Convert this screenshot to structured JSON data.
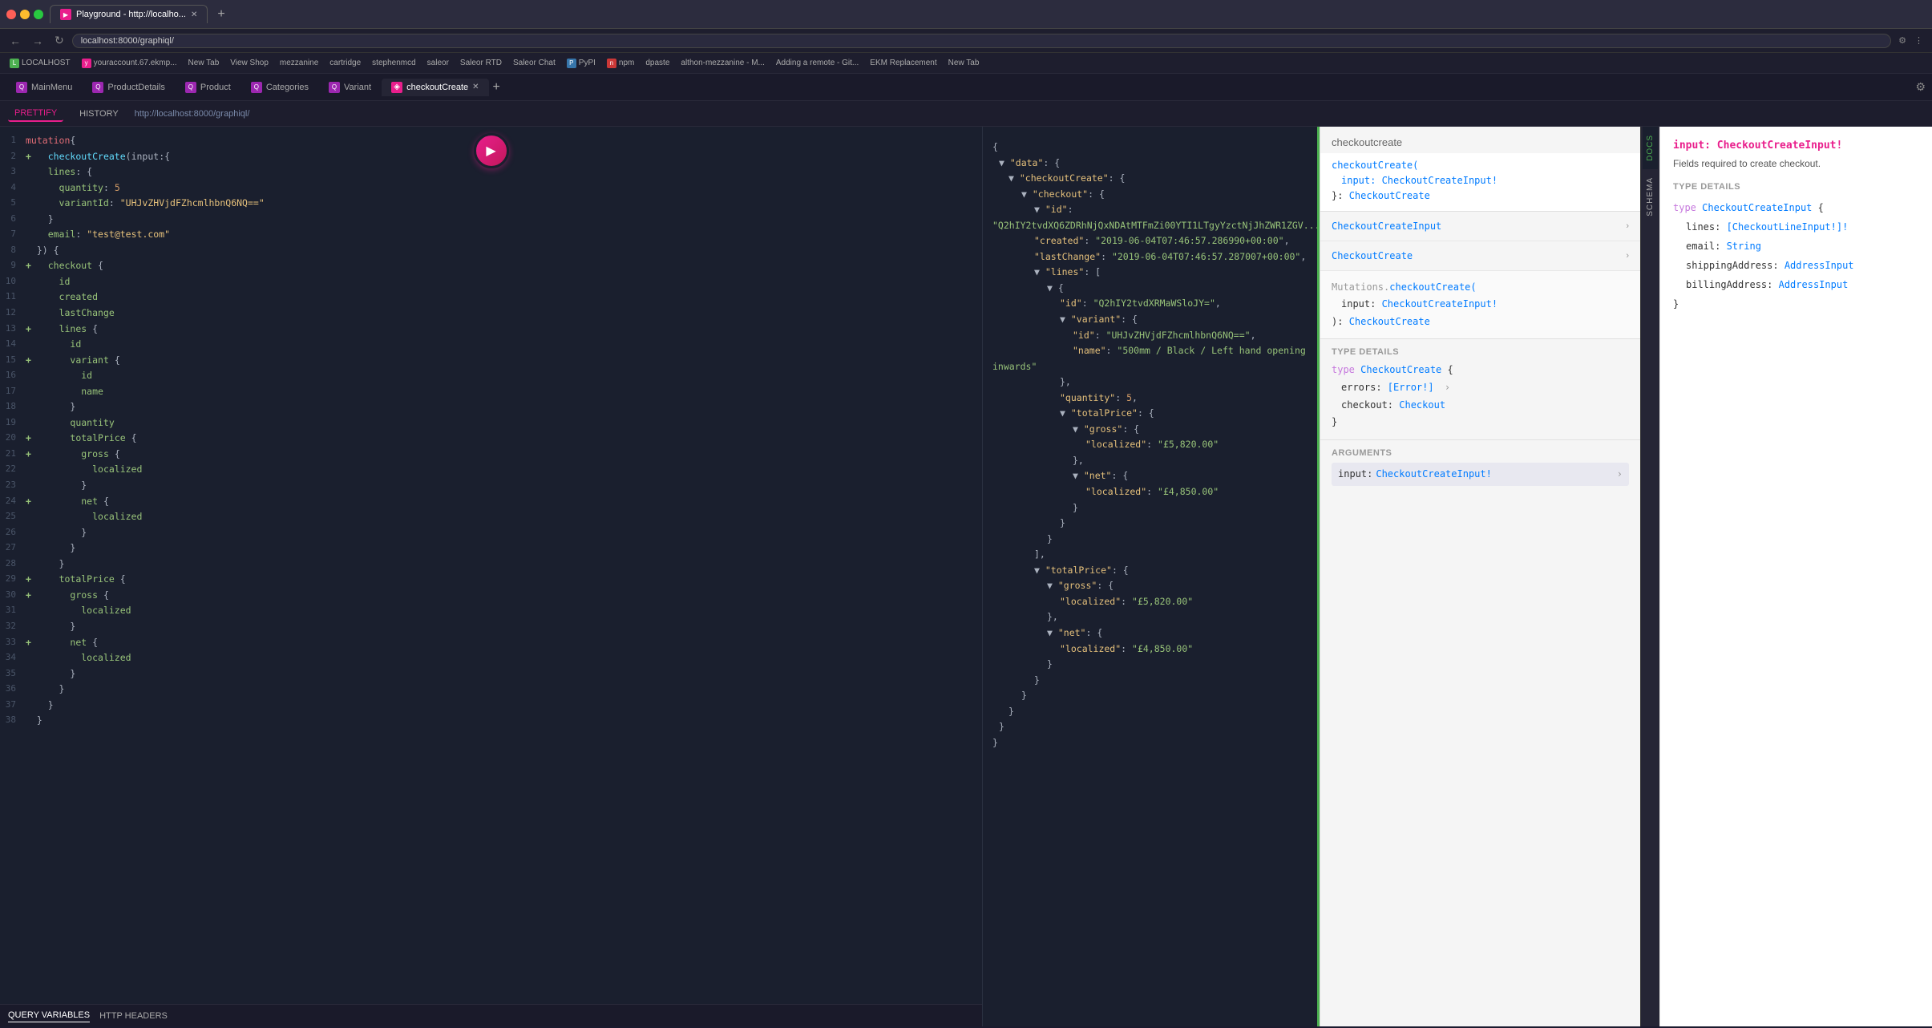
{
  "browser": {
    "tab_label": "Playground - http://localho...",
    "favicon": "▶",
    "url": "localhost:8000/graphiql/",
    "new_tab": "+"
  },
  "bookmarks": [
    {
      "label": "LOCALHOST",
      "color": "#4CAF50"
    },
    {
      "label": "youraccount.67.ekmp...",
      "color": "#e91e8c"
    },
    {
      "label": "New Tab"
    },
    {
      "label": "View Shop"
    },
    {
      "label": "mezzanine"
    },
    {
      "label": "cartridge"
    },
    {
      "label": "stephenmcd"
    },
    {
      "label": "saleor"
    },
    {
      "label": "Saleor RTD"
    },
    {
      "label": "Saleor Chat"
    },
    {
      "label": "PyPI"
    },
    {
      "label": "npm"
    },
    {
      "label": "dpaste"
    },
    {
      "label": "althon-mezzanine - M..."
    },
    {
      "label": "Adding a remote - Git..."
    },
    {
      "label": "EKM Replacement"
    },
    {
      "label": "New Tab"
    }
  ],
  "app_tabs": [
    {
      "label": "MainMenu",
      "icon": "Q",
      "icon_color": "#9c27b0",
      "active": false
    },
    {
      "label": "ProductDetails",
      "icon": "Q",
      "icon_color": "#9c27b0",
      "active": false
    },
    {
      "label": "Product",
      "icon": "Q",
      "icon_color": "#9c27b0",
      "active": false
    },
    {
      "label": "Categories",
      "icon": "Q",
      "icon_color": "#9c27b0",
      "active": false
    },
    {
      "label": "Variant",
      "icon": "Q",
      "icon_color": "#9c27b0",
      "active": false
    },
    {
      "label": "checkoutCreate",
      "icon": "◈",
      "icon_color": "#e91e8c",
      "active": true,
      "closeable": true
    }
  ],
  "toolbar": {
    "prettify": "PRETTIFY",
    "history": "HISTORY",
    "url": "http://localhost:8000/graphiql/"
  },
  "editor": {
    "lines": [
      {
        "num": "1",
        "content": "mutation{",
        "tokens": [
          {
            "t": "kw",
            "v": "mutation"
          },
          {
            "t": "punc",
            "v": "{"
          }
        ]
      },
      {
        "num": "2",
        "content": "  checkoutCreate(input:{",
        "tokens": [
          {
            "t": "plus",
            "v": "+"
          },
          {
            "t": "fn",
            "v": "  checkoutCreate"
          },
          {
            "t": "punc",
            "v": "(input:{"
          },
          {
            "t": "punc",
            "v": ""
          }
        ]
      },
      {
        "num": "3",
        "content": "    lines: {"
      },
      {
        "num": "4",
        "content": "      quantity: 5"
      },
      {
        "num": "5",
        "content": "      variantId: \"UHJvZHVjdFZhcmlhbnQ6NQ==\""
      },
      {
        "num": "6",
        "content": "    }"
      },
      {
        "num": "7",
        "content": "    email: \"test@test.com\""
      },
      {
        "num": "8",
        "content": "  }) {"
      },
      {
        "num": "9",
        "content": "    checkout {"
      },
      {
        "num": "10",
        "content": "      id"
      },
      {
        "num": "11",
        "content": "      created"
      },
      {
        "num": "12",
        "content": "      lastChange"
      },
      {
        "num": "13",
        "content": "      lines {"
      },
      {
        "num": "14",
        "content": "        id"
      },
      {
        "num": "15",
        "content": "        variant {"
      },
      {
        "num": "16",
        "content": "          id"
      },
      {
        "num": "17",
        "content": "          name"
      },
      {
        "num": "18",
        "content": "        }"
      },
      {
        "num": "19",
        "content": "        quantity"
      },
      {
        "num": "20",
        "content": "        totalPrice {"
      },
      {
        "num": "21",
        "content": "          gross {"
      },
      {
        "num": "22",
        "content": "            localized"
      },
      {
        "num": "23",
        "content": "          }"
      },
      {
        "num": "24",
        "content": "          net {"
      },
      {
        "num": "25",
        "content": "            localized"
      },
      {
        "num": "26",
        "content": "          }"
      },
      {
        "num": "27",
        "content": "        }"
      },
      {
        "num": "28",
        "content": "      }"
      },
      {
        "num": "29",
        "content": "      totalPrice {"
      },
      {
        "num": "30",
        "content": "        gross {"
      },
      {
        "num": "31",
        "content": "          localized"
      },
      {
        "num": "32",
        "content": "        }"
      },
      {
        "num": "33",
        "content": "        net {"
      },
      {
        "num": "34",
        "content": "          localized"
      },
      {
        "num": "35",
        "content": "        }"
      },
      {
        "num": "36",
        "content": "      }"
      },
      {
        "num": "37",
        "content": "    }"
      },
      {
        "num": "38",
        "content": "  }"
      }
    ]
  },
  "results": {
    "json": "{\n  \"data\": {\n    \"checkoutCreate\": {\n      \"checkout\": {\n        \"id\": \"Q2hIY2tvdXQ6ZDRhNjQxNDAtMTFmZi00YTI1LTgyYzctNjJhZWR1ZGV...\",\n        \"created\": \"2019-06-04T07:46:57.286990+00:00\",\n        \"lastChange\": \"2019-06-04T07:46:57.287007+00:00\",\n        \"lines\": [\n          {\n            \"id\": \"Q2hIY2tvdXRMaWSloJY=\",\n            \"variant\": {\n              \"id\": \"UHJvZHVjdFZhcmlhbnQ6NQ==\",\n              \"name\": \"500mm / Black / Left hand opening inwards\"\n            },\n            \"quantity\": 5,\n            \"totalPrice\": {\n              \"gross\": {\n                \"localized\": \"£5,820.00\"\n              },\n              \"net\": {\n                \"localized\": \"£4,850.00\"\n              }\n            }\n          }\n        ],\n        \"totalPrice\": {\n          \"gross\": {\n            \"localized\": \"£5,820.00\"\n          },\n          \"net\": {\n            \"localized\": \"£4,850.00\"\n          }\n        }\n      }\n    }\n  }\n}"
  },
  "docs_explorer": {
    "title": "checkoutcreate",
    "breadcrumb_root": "checkoutCreate(",
    "breadcrumb_input": "input: CheckoutCreateInput!",
    "breadcrumb_separator": "}:",
    "breadcrumb_return": "CheckoutCreate",
    "sections": [
      {
        "title": "CheckoutCreateInput",
        "items": [
          {
            "label": "CheckoutCreateInput",
            "arrow": true
          }
        ]
      },
      {
        "title": "CheckoutCreate",
        "items": [
          {
            "label": "CheckoutCreate",
            "arrow": true
          }
        ]
      }
    ],
    "mutation_detail": {
      "prefix": "Mutations.",
      "name": "checkoutCreate(",
      "input_label": "input:",
      "input_type": "CheckoutCreateInput!",
      "return_label": "):",
      "return_type": "CheckoutCreate"
    },
    "type_details_title": "TYPE DETAILS",
    "type_checkout_create": "type CheckoutCreate {",
    "errors_label": "errors:",
    "errors_type": "[Error!]",
    "checkout_label": "checkout:",
    "checkout_type": "Checkout",
    "close_brace": "}",
    "arguments_title": "ARGUMENTS",
    "argument_input_label": "input:",
    "argument_input_type": "CheckoutCreateInput!"
  },
  "right_docs": {
    "title": "input: CheckoutCreateInput!",
    "description": "Fields required to create checkout.",
    "type_details_title": "TYPE DETAILS",
    "type_def": "type CheckoutCreateInput {",
    "fields": [
      {
        "name": "lines:",
        "type": "[CheckoutLineInput!]!"
      },
      {
        "name": "email:",
        "type": "String"
      },
      {
        "name": "shippingAddress:",
        "type": "AddressInput"
      },
      {
        "name": "billingAddress:",
        "type": "AddressInput"
      }
    ],
    "close_brace": "}"
  },
  "query_vars": {
    "tab1": "QUERY VARIABLES",
    "tab2": "HTTP HEADERS"
  }
}
